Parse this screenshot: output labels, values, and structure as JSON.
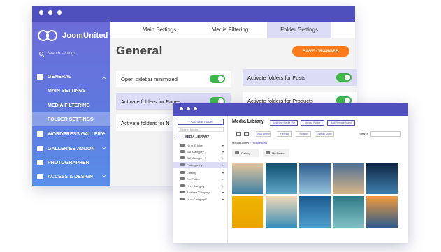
{
  "back": {
    "brand": "JoomUnited",
    "search_placeholder": "Search settings",
    "sidebar": [
      {
        "label": "GENERAL",
        "type": "main"
      },
      {
        "label": "MAIN SETTINGS",
        "type": "sub"
      },
      {
        "label": "MEDIA FILTERING",
        "type": "sub"
      },
      {
        "label": "FOLDER SETTINGS",
        "type": "sub",
        "active": true
      },
      {
        "label": "WORDPRESS GALLERY",
        "type": "main"
      },
      {
        "label": "GALLERIES ADDON",
        "type": "main"
      },
      {
        "label": "PHOTOGRAPHER",
        "type": "main"
      },
      {
        "label": "ACCESS & DESIGN",
        "type": "main"
      }
    ],
    "tabs": [
      "Main Settings",
      "Media Filtering",
      "Folder Settings"
    ],
    "title": "General",
    "save_label": "SAVE CHANGES",
    "options": {
      "o1": "Open sidebar minimized",
      "o2": "Activate folders for Posts",
      "o3": "Activate folders for Pages",
      "o4": "Activate folders for Products",
      "o5": "Activate folders for N"
    }
  },
  "front": {
    "add_folder": "+ Add New Folder",
    "search_placeholder": "Search folders...",
    "library_label": "MEDIA LIBRARY",
    "tree": [
      {
        "label": "Hy m Et lolor"
      },
      {
        "label": "Sub Category 1"
      },
      {
        "label": "Sub Category 2"
      },
      {
        "label": "Photography",
        "selected": true
      },
      {
        "label": "Catalog"
      },
      {
        "label": "File Folder"
      },
      {
        "label": "Ht m Category"
      },
      {
        "label": "Anothe r Category"
      },
      {
        "label": "Ht m Category 0"
      }
    ],
    "title": "Media Library",
    "buttons": [
      "Add New Media File",
      "Upload Folder",
      "Add Remote Video"
    ],
    "bulk": [
      "Bulk select",
      "Filtering",
      "Sorting",
      "Display Mode"
    ],
    "search_label": "Search",
    "crumb_prefix": "Media Library / ",
    "crumb_current": "Photography",
    "folders": [
      "Gallery",
      "My Photos"
    ],
    "thumb_colors": [
      [
        "#e9c79a",
        "#3b7fa6"
      ],
      [
        "#0e4e6e",
        "#5fa6c8"
      ],
      [
        "#2a5a8c",
        "#97c3de"
      ],
      [
        "#4a6d96",
        "#d9b78a"
      ],
      [
        "#0d2440",
        "#3e7fae"
      ],
      [
        "#f0b400",
        "#e9a400"
      ],
      [
        "#f2d9b8",
        "#3a8eb8"
      ],
      [
        "#1c5b8f",
        "#4fa0d0"
      ],
      [
        "#2f7a86",
        "#7fc0c4"
      ],
      [
        "#f39a3b",
        "#2d5c8d"
      ]
    ]
  }
}
